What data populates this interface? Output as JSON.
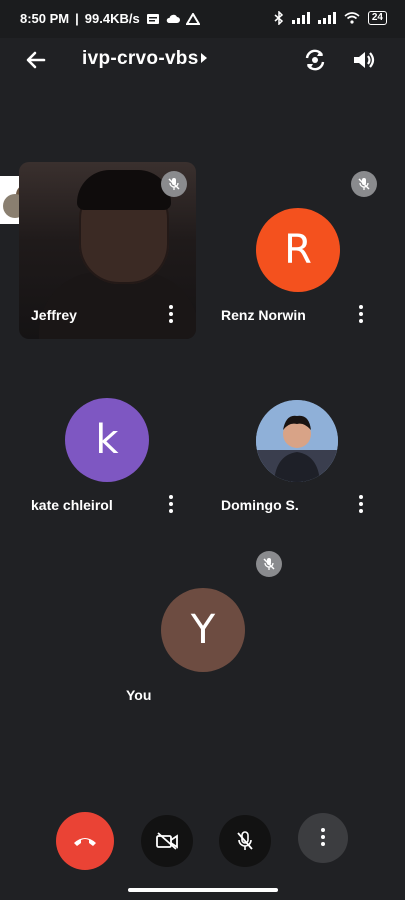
{
  "status": {
    "time": "8:50 PM",
    "speed": "99.4KB/s",
    "battery": "24"
  },
  "header": {
    "room_code": "ivp-crvo-vbs"
  },
  "participants": [
    {
      "name": "Jeffrey"
    },
    {
      "name": "Renz Norwin",
      "initial": "R"
    },
    {
      "name": "kate chleirol",
      "initial": "k"
    },
    {
      "name": "Domingo S."
    },
    {
      "name": "You",
      "initial": "Y"
    }
  ],
  "icons": {
    "back": "arrow-left-icon",
    "flip": "switch-camera-icon",
    "speaker": "speaker-icon",
    "end_call": "end-call-icon",
    "camera_off": "camera-off-icon",
    "mic_off": "mic-off-icon",
    "more": "more-vertical-icon",
    "messenger": "messenger-icon"
  },
  "colors": {
    "background": "#202124",
    "end_call": "#ea4335",
    "avatar_r": "#f4511e",
    "avatar_k": "#7e57c2",
    "avatar_y": "#6d4c41"
  }
}
